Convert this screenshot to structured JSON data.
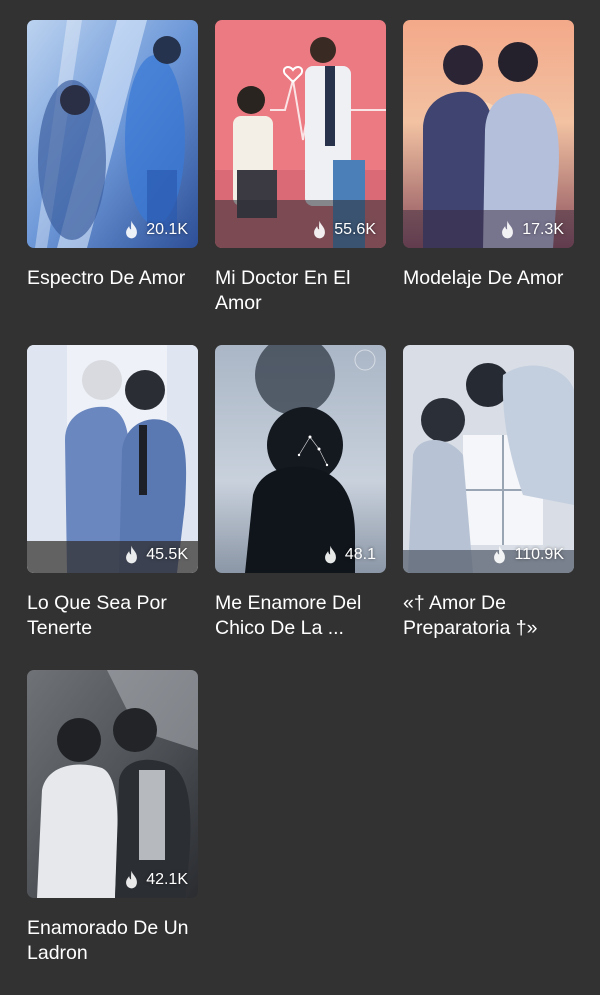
{
  "books": [
    {
      "title": "Espectro De Amor",
      "views": "20.1K",
      "cover_colors": [
        "#3f6fc4",
        "#c9dcf2",
        "#6fa8e8"
      ]
    },
    {
      "title": "Mi Doctor En El Amor",
      "views": "55.6K",
      "cover_colors": [
        "#e9747f",
        "#f4b3b6",
        "#2e3e66"
      ]
    },
    {
      "title": "Modelaje De Amor",
      "views": "17.3K",
      "cover_colors": [
        "#f0a07a",
        "#5a3a5e",
        "#2a2a48"
      ]
    },
    {
      "title": "Lo Que Sea Por Tenerte",
      "views": "45.5K",
      "cover_colors": [
        "#eef2f8",
        "#5e7cb4",
        "#2b2f3c"
      ]
    },
    {
      "title": "Me Enamore Del Chico De La ...",
      "views": "48.1",
      "cover_colors": [
        "#a8b4c4",
        "#28303c",
        "#10141a"
      ]
    },
    {
      "title": "«† Amor De Preparatoria †»",
      "views": "110.9K",
      "cover_colors": [
        "#d7dde6",
        "#7a8ea6",
        "#394353"
      ]
    },
    {
      "title": "Enamorado De Un Ladron",
      "views": "42.1K",
      "cover_colors": [
        "#5b5f63",
        "#e3e5e8",
        "#1f2124"
      ]
    }
  ]
}
